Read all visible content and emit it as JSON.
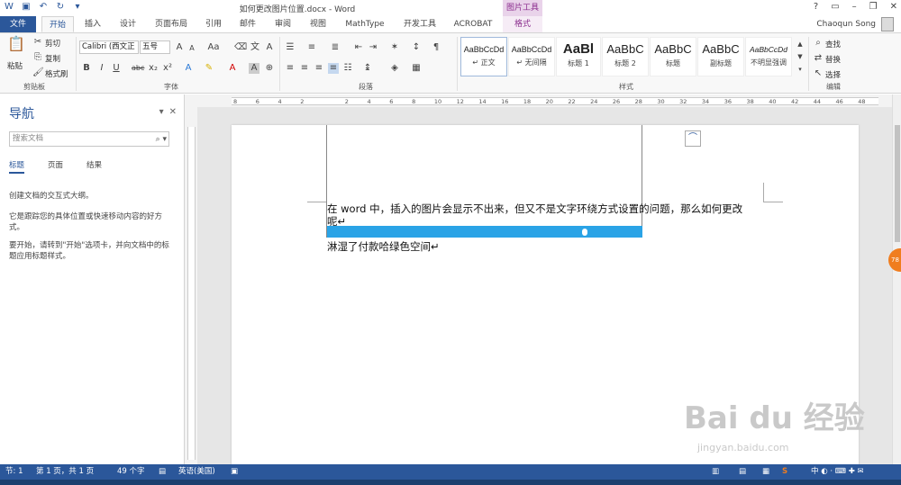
{
  "window": {
    "title": "如何更改图片位置.docx - Word",
    "context_tab_header": "图片工具",
    "controls": [
      "?",
      "▭",
      "–",
      "❐",
      "✕"
    ]
  },
  "tabs": [
    "文件",
    "开始",
    "插入",
    "设计",
    "页面布局",
    "引用",
    "邮件",
    "审阅",
    "视图",
    "MathType",
    "开发工具",
    "ACROBAT",
    "格式"
  ],
  "user": {
    "name": "Chaoqun Song"
  },
  "ribbon": {
    "clipboard": {
      "paste": "粘贴",
      "cut": "剪切",
      "copy": "复制",
      "format_painter": "格式刷",
      "label": "剪贴板"
    },
    "font": {
      "name": "Calibri (西文正",
      "size": "五号",
      "label": "字体"
    },
    "paragraph": {
      "label": "段落"
    },
    "styles": {
      "label": "样式",
      "items": [
        {
          "sample": "AaBbCcDd",
          "name": "↵ 正文"
        },
        {
          "sample": "AaBbCcDd",
          "name": "↵ 无间隔"
        },
        {
          "sample": "AaBl",
          "name": "标题 1"
        },
        {
          "sample": "AaBbC",
          "name": "标题 2"
        },
        {
          "sample": "AaBbC",
          "name": "标题"
        },
        {
          "sample": "AaBbC",
          "name": "副标题"
        },
        {
          "sample": "AaBbCcDd",
          "name": "不明显强调"
        }
      ]
    },
    "editing": {
      "find": "查找",
      "replace": "替换",
      "select": "选择",
      "label": "编辑"
    }
  },
  "nav": {
    "title": "导航",
    "search_placeholder": "搜索文档",
    "tabs": [
      "标题",
      "页面",
      "结果"
    ],
    "p1": "创建文档的交互式大纲。",
    "p2": "它是跟踪您的具体位置或快速移动内容的好方式。",
    "p3": "要开始，请转到\"开始\"选项卡，并向文档中的标题应用标题样式。"
  },
  "ruler": {
    "numbers": [
      "8",
      "6",
      "4",
      "2",
      "",
      "2",
      "4",
      "6",
      "8",
      "10",
      "12",
      "14",
      "16",
      "18",
      "20",
      "22",
      "24",
      "26",
      "28",
      "30",
      "32",
      "34",
      "36",
      "38",
      "40",
      "42",
      "44",
      "46",
      "48"
    ]
  },
  "document": {
    "line1": "在 word 中，插入的图片会显示不出来，但又不是文字环绕方式设置的问题，那么如何更改",
    "line2": "呢↵",
    "line3": "淋湿了付款哈绿色空间↵"
  },
  "status": {
    "section": "节: 1",
    "page": "第 1 页，共 1 页",
    "words": "49 个字",
    "language": "英语(美国)"
  },
  "watermark": {
    "brand": "Bai du 经验",
    "url": "jingyan.baidu.com"
  },
  "badge": "78"
}
